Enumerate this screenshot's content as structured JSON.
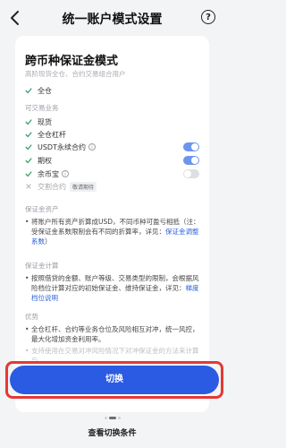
{
  "header": {
    "title": "统一账户模式设置",
    "help_icon": "?"
  },
  "card": {
    "mode_title": "跨币种保证金模式",
    "mode_subtitle": "高阶现货全仓、合约交易组合用户",
    "mode_features": [
      {
        "label": "全仓"
      }
    ],
    "tradable_section_label": "可交易业务",
    "tradable": [
      {
        "label": "现货",
        "enabled": true
      },
      {
        "label": "全仓杠杆",
        "enabled": true
      },
      {
        "label": "USDT永续合约",
        "enabled": true,
        "toggle": true,
        "toggle_on": true
      },
      {
        "label": "期权",
        "enabled": true,
        "toggle": true,
        "toggle_on": true
      },
      {
        "label": "余币宝",
        "enabled": true,
        "toggle": true,
        "toggle_on": false
      },
      {
        "label": "交割合约",
        "enabled": false,
        "tag": "敬请期待"
      }
    ],
    "assets_label": "保证金资产",
    "assets_text": "将账户所有资产折算成USD，不同币种可盈亏相抵（注：受保证金系数限制会有不同的折算率，详见：",
    "assets_link": "保证金调整系数",
    "assets_tail": "）",
    "calc_label": "保证金计算",
    "calc_text": "按照借贷的金额、账户等级、交易类型的限制，会根据风险档位计算对应的初始保证金、维持保证金，详见：",
    "calc_link": "梯度档位说明",
    "adv_label": "优势",
    "adv_text": "全仓杠杆、合约等业务仓位及风险相互对冲，统一风控，最大化增加资金利用率。",
    "adv_text2": "支持使用在交易对冲风险情况下对冲保证金的方法来计算与"
  },
  "switch_button": "切换",
  "bottom_link": "查看切换条件",
  "colors": {
    "accent": "#2b5be3",
    "check": "#3a9e6b",
    "toggle_on": "#6e95ec",
    "highlight_border": "#e53935"
  }
}
